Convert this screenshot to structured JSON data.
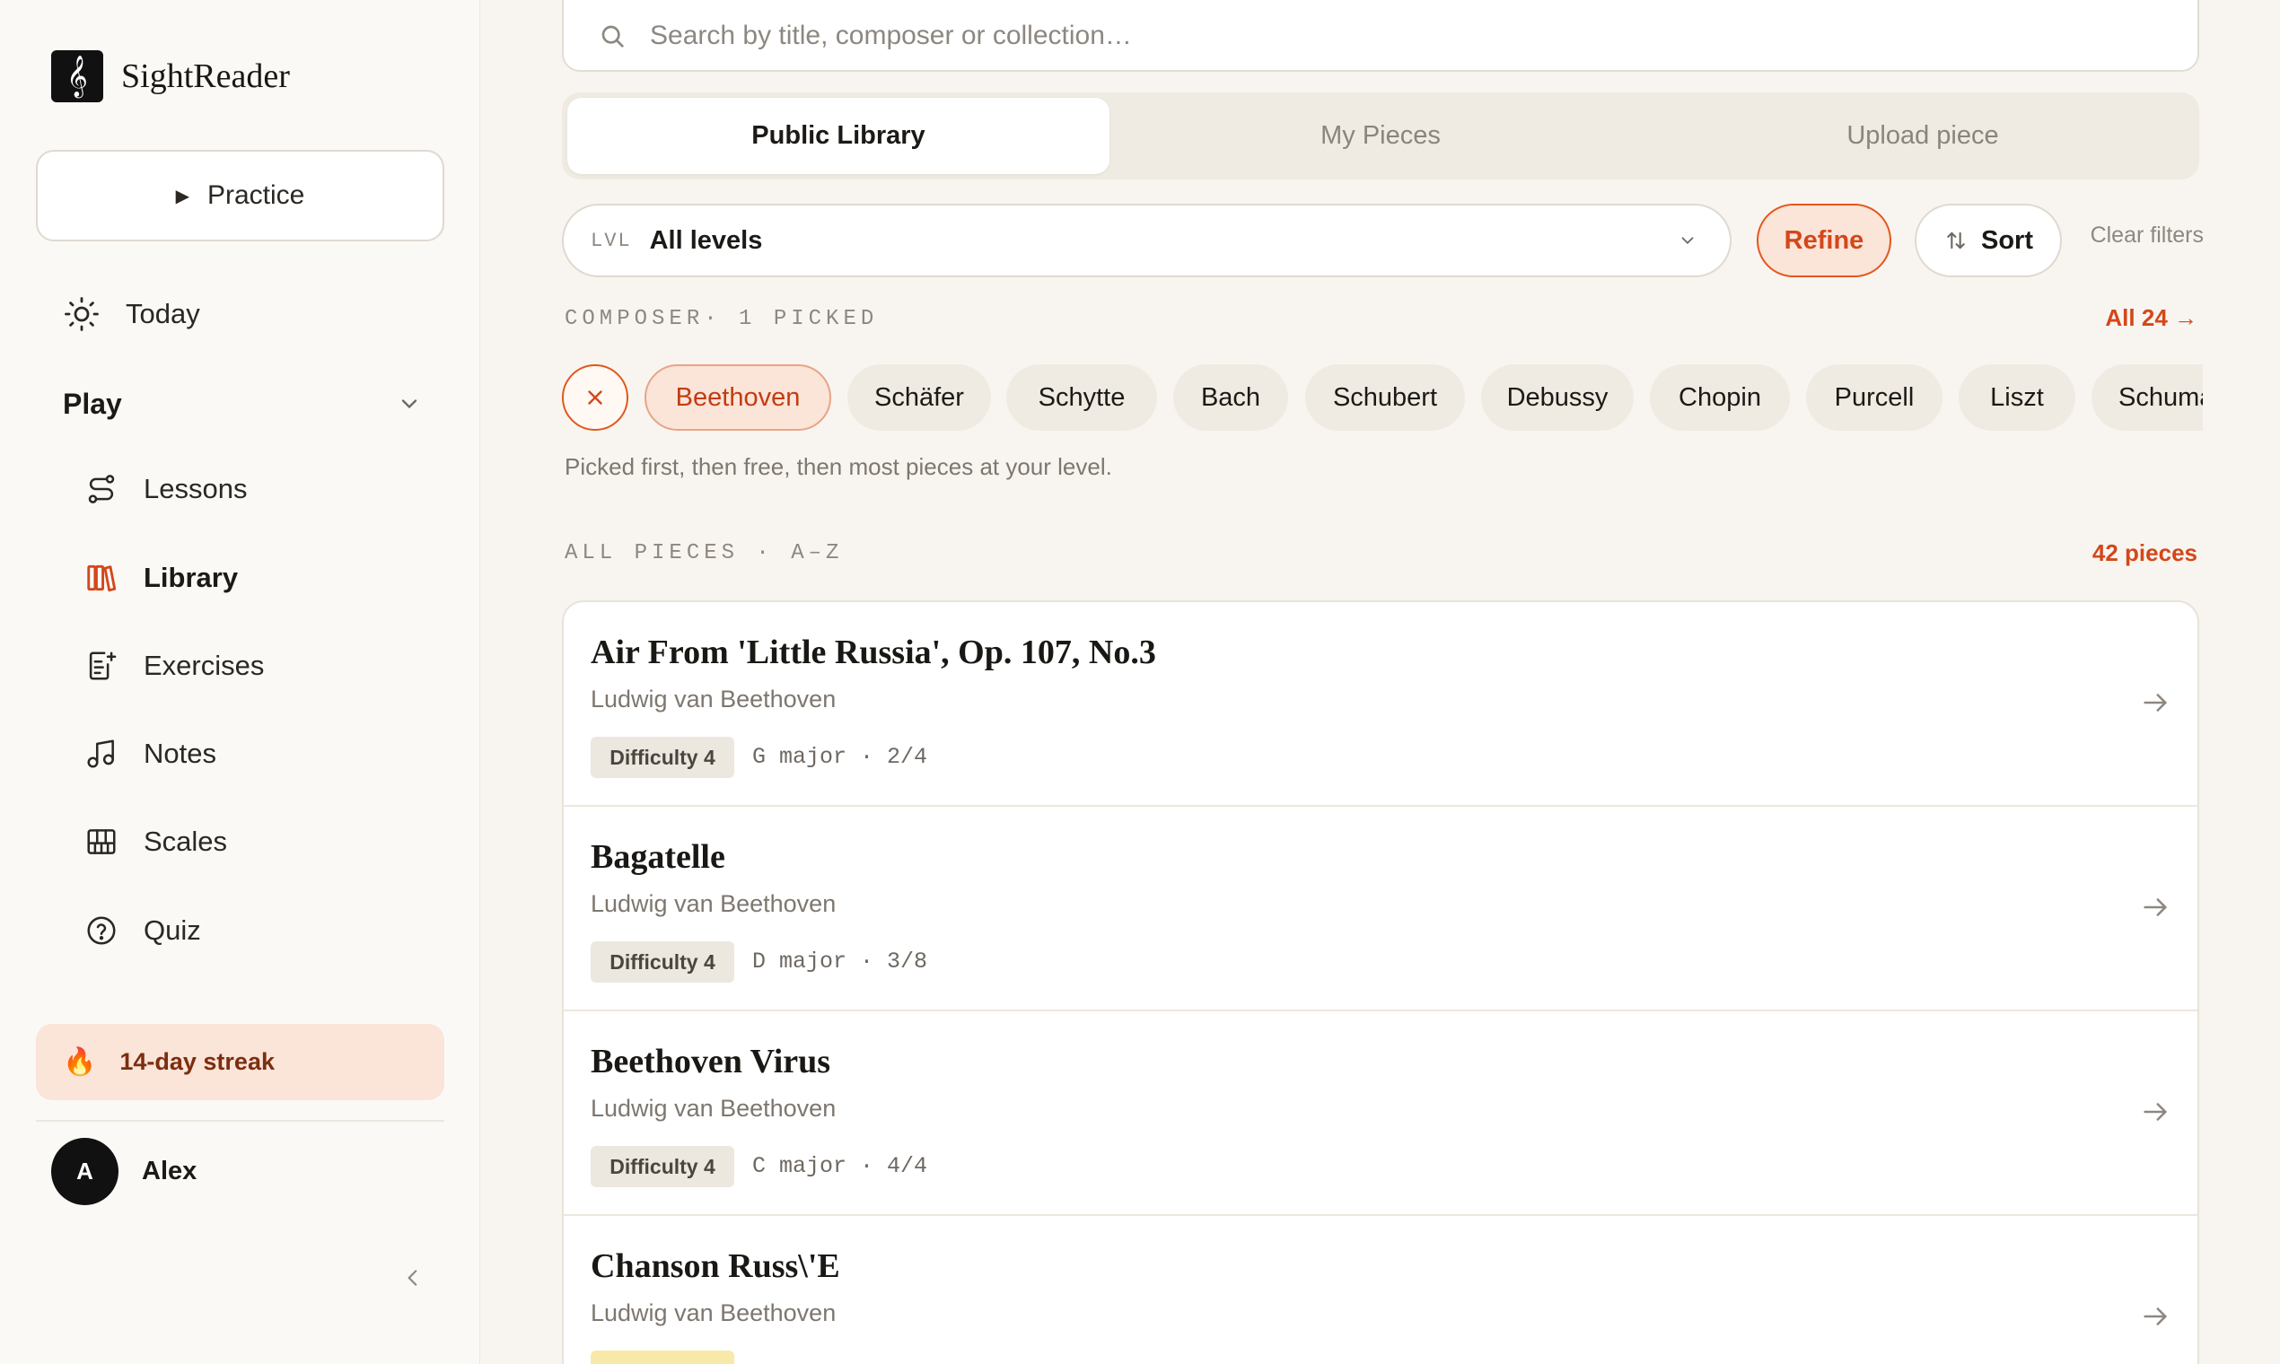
{
  "app": {
    "name": "SightReader",
    "logo_glyph": "𝄞"
  },
  "sidebar": {
    "practice_label": "Practice",
    "today_label": "Today",
    "group_label": "Play",
    "items": [
      {
        "label": "Lessons",
        "icon": "route-icon"
      },
      {
        "label": "Library",
        "icon": "library-icon",
        "active": true
      },
      {
        "label": "Exercises",
        "icon": "exercise-icon"
      },
      {
        "label": "Notes",
        "icon": "music-note-icon"
      },
      {
        "label": "Scales",
        "icon": "piano-keys-icon"
      },
      {
        "label": "Quiz",
        "icon": "help-circle-icon"
      }
    ],
    "streak_label": "14-day streak",
    "user": {
      "initial": "A",
      "name": "Alex"
    }
  },
  "search": {
    "placeholder": "Search by title, composer or collection…"
  },
  "tabs": [
    {
      "label": "Public Library",
      "active": true
    },
    {
      "label": "My Pieces"
    },
    {
      "label": "Upload piece"
    }
  ],
  "filters": {
    "level_prefix": "LVL",
    "level_value": "All levels",
    "refine_label": "Refine",
    "sort_label": "Sort",
    "clear_label": "Clear filters"
  },
  "composer_section": {
    "label": "COMPOSER· 1 PICKED",
    "all_link": "All 24 →",
    "chips": [
      "Beethoven",
      "Schäfer",
      "Schytte",
      "Bach",
      "Schubert",
      "Debussy",
      "Chopin",
      "Purcell",
      "Liszt",
      "Schumann"
    ],
    "helper": "Picked first, then free, then most pieces at your level."
  },
  "pieces_section": {
    "label": "ALL PIECES · A–Z",
    "count": "42 pieces",
    "rows": [
      {
        "title": "Air From 'Little Russia', Op. 107, No.3",
        "composer": "Ludwig van Beethoven",
        "difficulty": "Difficulty 4",
        "meta": "G major · 2/4"
      },
      {
        "title": "Bagatelle",
        "composer": "Ludwig van Beethoven",
        "difficulty": "Difficulty 4",
        "meta": "D major · 3/8"
      },
      {
        "title": "Beethoven Virus",
        "composer": "Ludwig van Beethoven",
        "difficulty": "Difficulty 4",
        "meta": "C major · 4/4"
      },
      {
        "title": "Chanson Russ\\'E",
        "composer": "Ludwig van Beethoven",
        "difficulty": "",
        "meta": ""
      }
    ]
  },
  "colors": {
    "accent": "#d4471a",
    "accent_soft": "#fbe4d8",
    "chip_bg": "#efebe2"
  }
}
